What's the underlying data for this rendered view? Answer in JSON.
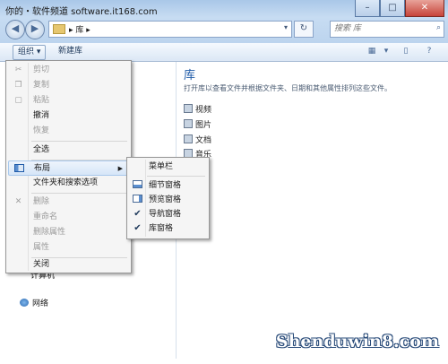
{
  "watermark_top": "你的・软件频道 software.it168.com",
  "watermark_bottom": "Shenduwin8.com",
  "window_buttons": {
    "minimize": "–",
    "maximize": "□",
    "close": "✕"
  },
  "address": {
    "crumb": "▸ 库 ▸"
  },
  "search": {
    "placeholder": "搜索 库"
  },
  "toolbar": {
    "organize_label": "组织 ▾",
    "new_library_label": "新建库"
  },
  "content": {
    "title": "库",
    "description": "打开库以查看文件并根据文件夹、日期和其他属性排列这些文件。",
    "libraries": [
      "视频",
      "图片",
      "文档",
      "音乐"
    ]
  },
  "nav_pane": {
    "partial_item": "计算机",
    "network": "网络"
  },
  "organize_menu": {
    "items": [
      {
        "label": "剪切",
        "enabled": false,
        "icon": "scissors-icon"
      },
      {
        "label": "复制",
        "enabled": false,
        "icon": "copy-icon"
      },
      {
        "label": "粘贴",
        "enabled": false,
        "icon": "paste-icon"
      },
      {
        "label": "撤消",
        "enabled": true
      },
      {
        "label": "恢复",
        "enabled": false
      },
      {
        "label": "全选",
        "enabled": true
      },
      {
        "label": "布局",
        "enabled": true,
        "icon": "layout-icon",
        "submenu": true
      },
      {
        "label": "文件夹和搜索选项",
        "enabled": true
      },
      {
        "label": "删除",
        "enabled": false,
        "icon": "delete-x-icon"
      },
      {
        "label": "重命名",
        "enabled": false
      },
      {
        "label": "删除属性",
        "enabled": false
      },
      {
        "label": "属性",
        "enabled": false
      },
      {
        "label": "关闭",
        "enabled": true
      }
    ]
  },
  "layout_submenu": {
    "items": [
      {
        "label": "菜单栏",
        "checked": false
      },
      {
        "label": "细节窗格",
        "checked": false,
        "icon": "details-pane-icon"
      },
      {
        "label": "预览窗格",
        "checked": false,
        "icon": "preview-pane-icon"
      },
      {
        "label": "导航窗格",
        "checked": true
      },
      {
        "label": "库窗格",
        "checked": true
      }
    ]
  },
  "colors": {
    "accent": "#1e5aa8",
    "menu_bg": "#f5f5f5",
    "disabled_text": "#9a9a9a"
  }
}
